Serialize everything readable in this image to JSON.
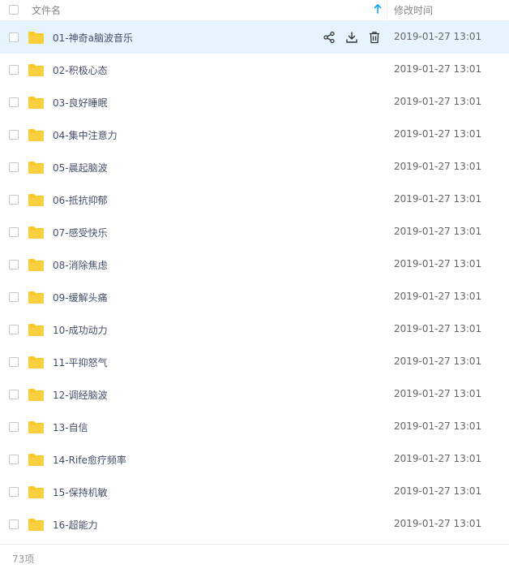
{
  "header": {
    "name_label": "文件名",
    "time_label": "修改时间",
    "sort_icon": "arrow-up-icon"
  },
  "colors": {
    "accent": "#06a7ff",
    "selected_row": "#e5f4fd",
    "folder": "#f9c92a"
  },
  "rows": [
    {
      "name": "01-神奇a脑波音乐",
      "time": "2019-01-27 13:01",
      "selected": true
    },
    {
      "name": "02-积极心态",
      "time": "2019-01-27 13:01"
    },
    {
      "name": "03-良好睡眠",
      "time": "2019-01-27 13:01"
    },
    {
      "name": "04-集中注意力",
      "time": "2019-01-27 13:01"
    },
    {
      "name": "05-晨起脑波",
      "time": "2019-01-27 13:01"
    },
    {
      "name": "06-抵抗抑郁",
      "time": "2019-01-27 13:01"
    },
    {
      "name": "07-感受快乐",
      "time": "2019-01-27 13:01"
    },
    {
      "name": "08-消除焦虑",
      "time": "2019-01-27 13:01"
    },
    {
      "name": "09-缓解头痛",
      "time": "2019-01-27 13:01"
    },
    {
      "name": "10-成功动力",
      "time": "2019-01-27 13:01"
    },
    {
      "name": "11-平抑怒气",
      "time": "2019-01-27 13:01"
    },
    {
      "name": "12-调经脑波",
      "time": "2019-01-27 13:01"
    },
    {
      "name": "13-自信",
      "time": "2019-01-27 13:01"
    },
    {
      "name": "14-Rife愈疗频率",
      "time": "2019-01-27 13:01"
    },
    {
      "name": "15-保持机敏",
      "time": "2019-01-27 13:01"
    },
    {
      "name": "16-超能力",
      "time": "2019-01-27 13:01"
    }
  ],
  "row_actions": [
    "share-icon",
    "download-icon",
    "delete-icon"
  ],
  "footer": {
    "count": "73项"
  }
}
